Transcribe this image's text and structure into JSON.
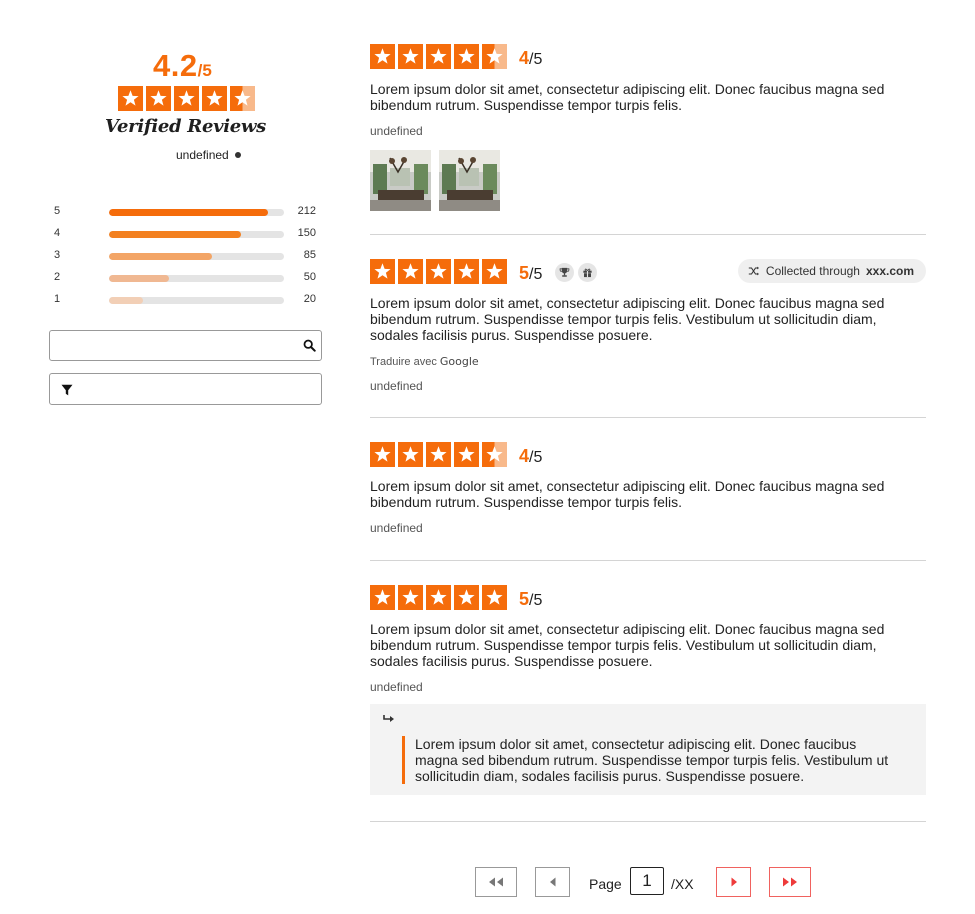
{
  "summary": {
    "average": "4.2",
    "average_suffix": "/5",
    "star_fill": [
      1,
      1,
      1,
      1,
      0.5
    ],
    "verified_label": "Verified Reviews",
    "undefined_text": "undefined",
    "distribution": [
      {
        "stars": "5",
        "count": "212",
        "fraction": 0.907,
        "color": "#f56c0b"
      },
      {
        "stars": "4",
        "count": "150",
        "fraction": 0.754,
        "color": "#f3801f"
      },
      {
        "stars": "3",
        "count": "85",
        "fraction": 0.589,
        "color": "#f3a566"
      },
      {
        "stars": "2",
        "count": "50",
        "fraction": 0.343,
        "color": "#f0b892"
      },
      {
        "stars": "1",
        "count": "20",
        "fraction": 0.194,
        "color": "#f2cfb6"
      }
    ]
  },
  "search": {
    "placeholder": "",
    "icon": "search-icon"
  },
  "filter": {
    "icon": "filter-icon"
  },
  "colors": {
    "accent": "#f56c0b",
    "star_empty": "#f8b98b",
    "pager_active": "#f0625f"
  },
  "reviews": [
    {
      "score": "4",
      "score_suffix": "/5",
      "star_fill": [
        1,
        1,
        1,
        1,
        0.5
      ],
      "text": "Lorem ipsum dolor sit amet, consectetur adipiscing elit. Donec faucibus magna sed bibendum rutrum. Suspendisse tempor turpis felis.",
      "meta": "undefined",
      "has_photos": true
    },
    {
      "score": "5",
      "score_suffix": "/5",
      "star_fill": [
        1,
        1,
        1,
        1,
        1
      ],
      "badges": [
        "trophy-icon",
        "gift-icon"
      ],
      "collected_prefix": "Collected through",
      "collected_site": "xxx.com",
      "text": "Lorem ipsum dolor sit amet, consectetur adipiscing elit. Donec faucibus magna sed bibendum rutrum. Suspendisse tempor turpis felis. Vestibulum ut sollicitudin diam, sodales facilisis purus. Suspendisse posuere.",
      "translate_label": "Traduire avec",
      "translate_brand": "Google",
      "meta": "undefined"
    },
    {
      "score": "4",
      "score_suffix": "/5",
      "star_fill": [
        1,
        1,
        1,
        1,
        0.5
      ],
      "text": "Lorem ipsum dolor sit amet, consectetur adipiscing elit. Donec faucibus magna sed bibendum rutrum. Suspendisse tempor turpis felis.",
      "meta": "undefined"
    },
    {
      "score": "5",
      "score_suffix": "/5",
      "star_fill": [
        1,
        1,
        1,
        1,
        1
      ],
      "text": "Lorem ipsum dolor sit amet, consectetur adipiscing elit. Donec faucibus magna sed bibendum rutrum. Suspendisse tempor turpis felis. Vestibulum ut sollicitudin diam, sodales facilisis purus. Suspendisse posuere.",
      "meta": "undefined",
      "reply": "Lorem ipsum dolor sit amet, consectetur adipiscing elit. Donec faucibus magna sed bibendum rutrum. Suspendisse tempor turpis felis. Vestibulum ut sollicitudin diam, sodales facilisis purus. Suspendisse posuere."
    }
  ],
  "pagination": {
    "page_label": "Page",
    "current_page": "1",
    "total": "/XX"
  }
}
